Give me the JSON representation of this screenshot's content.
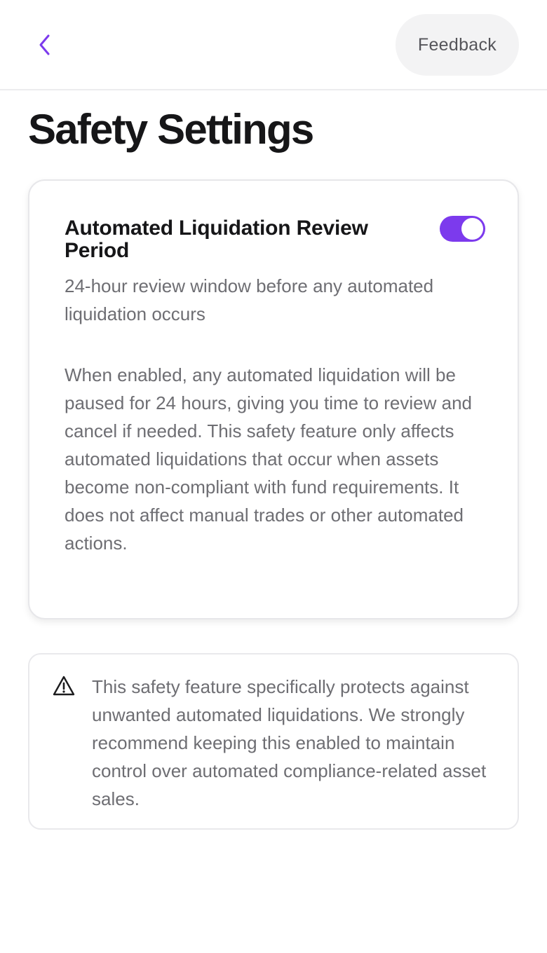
{
  "header": {
    "back_icon": "chevron-left-icon",
    "feedback_label": "Feedback",
    "accent_color": "#7c3aed"
  },
  "page": {
    "title": "Safety Settings"
  },
  "setting_card": {
    "title": "Automated Liquidation Review Period",
    "subtitle": "24-hour review window before any automated liquidation occurs",
    "description": "When enabled, any automated liquidation will be paused for 24 hours, giving you time to review and cancel if needed. This safety feature only affects automated liquidations that occur when assets become non-compliant with fund requirements. It does not affect manual trades or other automated actions.",
    "toggle_enabled": true,
    "toggle_color": "#7c3aed"
  },
  "notice": {
    "icon": "warning-triangle-icon",
    "text": "This safety feature specifically protects against unwanted automated liquidations. We strongly recommend keeping this enabled to maintain control over automated compliance-related asset sales."
  }
}
